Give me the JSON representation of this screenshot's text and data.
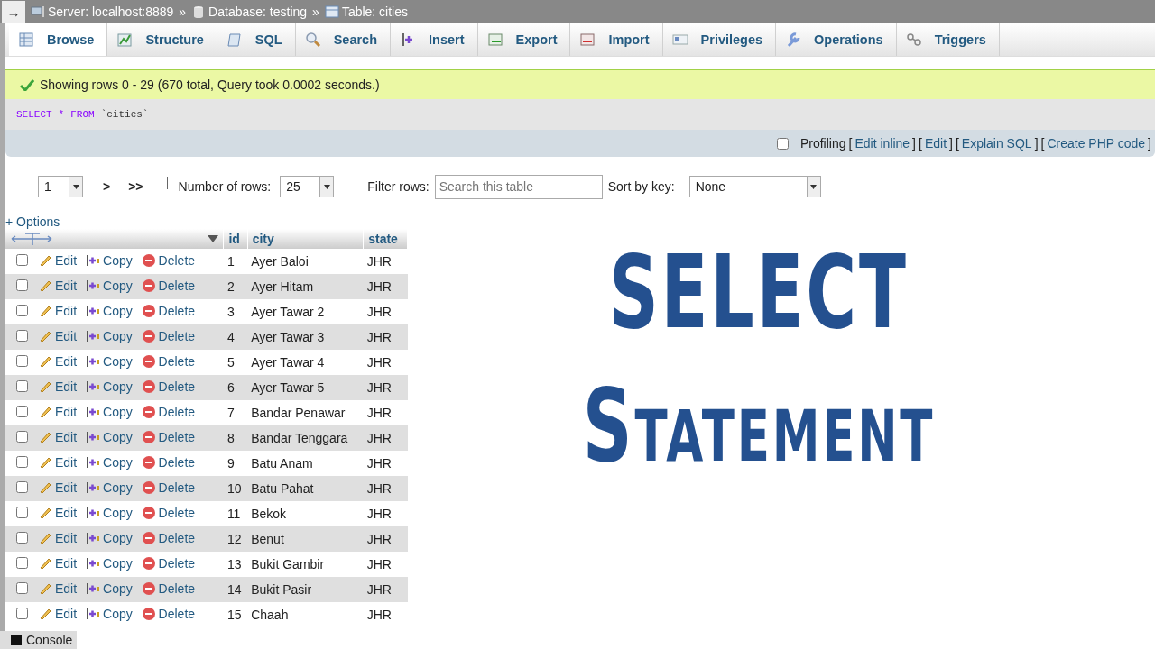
{
  "breadcrumb": {
    "toggle": "→",
    "items": [
      {
        "kind": "server",
        "label": "Server: localhost:8889"
      },
      {
        "kind": "database",
        "label": "Database: testing"
      },
      {
        "kind": "table",
        "label": "Table: cities"
      }
    ],
    "separator": "»"
  },
  "tabs": [
    {
      "label": "Browse",
      "selected": true
    },
    {
      "label": "Structure",
      "selected": false
    },
    {
      "label": "SQL",
      "selected": false
    },
    {
      "label": "Search",
      "selected": false
    },
    {
      "label": "Insert",
      "selected": false
    },
    {
      "label": "Export",
      "selected": false
    },
    {
      "label": "Import",
      "selected": false
    },
    {
      "label": "Privileges",
      "selected": false
    },
    {
      "label": "Operations",
      "selected": false
    },
    {
      "label": "Triggers",
      "selected": false
    }
  ],
  "message": "Showing rows 0 - 29 (670 total, Query took 0.0002 seconds.)",
  "query": {
    "keyword1": "SELECT",
    "star": "*",
    "keyword2": "FROM",
    "table": "`cities`"
  },
  "profiling": {
    "label": "Profiling",
    "checked": false,
    "links": [
      {
        "open": "[",
        "label": "Edit inline",
        "close": "]"
      },
      {
        "open": "[",
        "label": "Edit",
        "close": "]"
      },
      {
        "open": "[",
        "label": "Explain SQL",
        "close": "]"
      },
      {
        "open": "[",
        "label": "Create PHP code",
        "close": "]"
      }
    ]
  },
  "navigation": {
    "page": "1",
    "next": ">",
    "last": ">>",
    "rows_label": "Number of rows:",
    "rows_value": "25",
    "filter_label": "Filter rows:",
    "filter_placeholder": "Search this table",
    "sort_label": "Sort by key:",
    "sort_value": "None"
  },
  "options_link": "+ Options",
  "table": {
    "columns": [
      "id",
      "city",
      "state"
    ],
    "rows": [
      {
        "actions": [
          "Edit",
          "Copy",
          "Delete"
        ],
        "id": "1",
        "city": "Ayer Baloi",
        "state": "JHR",
        "checked": false
      },
      {
        "actions": [
          "Edit",
          "Copy",
          "Delete"
        ],
        "id": "2",
        "city": "Ayer Hitam",
        "state": "JHR",
        "checked": false
      },
      {
        "actions": [
          "Edit",
          "Copy",
          "Delete"
        ],
        "id": "3",
        "city": "Ayer Tawar 2",
        "state": "JHR",
        "checked": false
      },
      {
        "actions": [
          "Edit",
          "Copy",
          "Delete"
        ],
        "id": "4",
        "city": "Ayer Tawar 3",
        "state": "JHR",
        "checked": false
      },
      {
        "actions": [
          "Edit",
          "Copy",
          "Delete"
        ],
        "id": "5",
        "city": "Ayer Tawar 4",
        "state": "JHR",
        "checked": false
      },
      {
        "actions": [
          "Edit",
          "Copy",
          "Delete"
        ],
        "id": "6",
        "city": "Ayer Tawar 5",
        "state": "JHR",
        "checked": false
      },
      {
        "actions": [
          "Edit",
          "Copy",
          "Delete"
        ],
        "id": "7",
        "city": "Bandar Penawar",
        "state": "JHR",
        "checked": false
      },
      {
        "actions": [
          "Edit",
          "Copy",
          "Delete"
        ],
        "id": "8",
        "city": "Bandar Tenggara",
        "state": "JHR",
        "checked": false
      },
      {
        "actions": [
          "Edit",
          "Copy",
          "Delete"
        ],
        "id": "9",
        "city": "Batu Anam",
        "state": "JHR",
        "checked": false
      },
      {
        "actions": [
          "Edit",
          "Copy",
          "Delete"
        ],
        "id": "10",
        "city": "Batu Pahat",
        "state": "JHR",
        "checked": false
      },
      {
        "actions": [
          "Edit",
          "Copy",
          "Delete"
        ],
        "id": "11",
        "city": "Bekok",
        "state": "JHR",
        "checked": false
      },
      {
        "actions": [
          "Edit",
          "Copy",
          "Delete"
        ],
        "id": "12",
        "city": "Benut",
        "state": "JHR",
        "checked": false
      },
      {
        "actions": [
          "Edit",
          "Copy",
          "Delete"
        ],
        "id": "13",
        "city": "Bukit Gambir",
        "state": "JHR",
        "checked": false
      },
      {
        "actions": [
          "Edit",
          "Copy",
          "Delete"
        ],
        "id": "14",
        "city": "Bukit Pasir",
        "state": "JHR",
        "checked": false
      },
      {
        "actions": [
          "Edit",
          "Copy",
          "Delete"
        ],
        "id": "15",
        "city": "Chaah",
        "state": "JHR",
        "checked": false
      }
    ]
  },
  "overlay": {
    "line1": "SELECT",
    "line2": "Statement"
  },
  "console": "Console"
}
